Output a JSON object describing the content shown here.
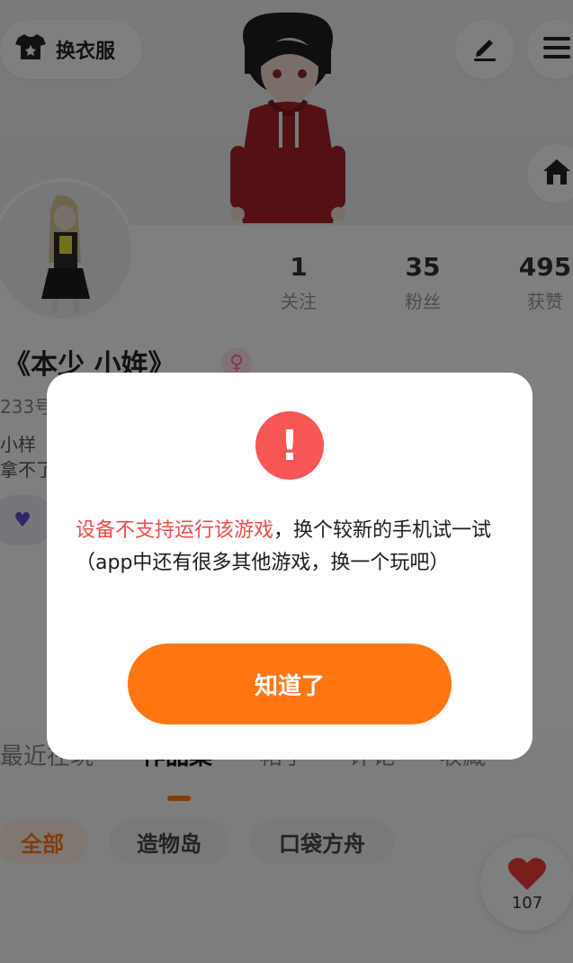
{
  "header": {
    "dress_up_label": "换衣服"
  },
  "stats": [
    {
      "value": "1",
      "label": "关注"
    },
    {
      "value": "35",
      "label": "粉丝"
    },
    {
      "value": "495",
      "label": "获赞"
    }
  ],
  "profile": {
    "nickname": "《本少 小姩》",
    "uid": "233号",
    "bio_line1": "小样",
    "bio_line2": "拿不了"
  },
  "tabs": [
    {
      "label": "最近在玩"
    },
    {
      "label": "作品集"
    },
    {
      "label": "帖子"
    },
    {
      "label": "评论"
    },
    {
      "label": "收藏"
    }
  ],
  "filters": [
    {
      "label": "全部"
    },
    {
      "label": "造物岛"
    },
    {
      "label": "口袋方舟"
    }
  ],
  "like_fab": {
    "count": "107"
  },
  "dialog": {
    "message_highlight": "设备不支持运行该游戏",
    "message_rest": "，换个较新的手机试一试（app中还有很多其他游戏，换一个玩吧）",
    "confirm_label": "知道了"
  },
  "colors": {
    "accent": "#ff7613",
    "alert": "#f85555",
    "highlight_text": "#f24b4b"
  }
}
